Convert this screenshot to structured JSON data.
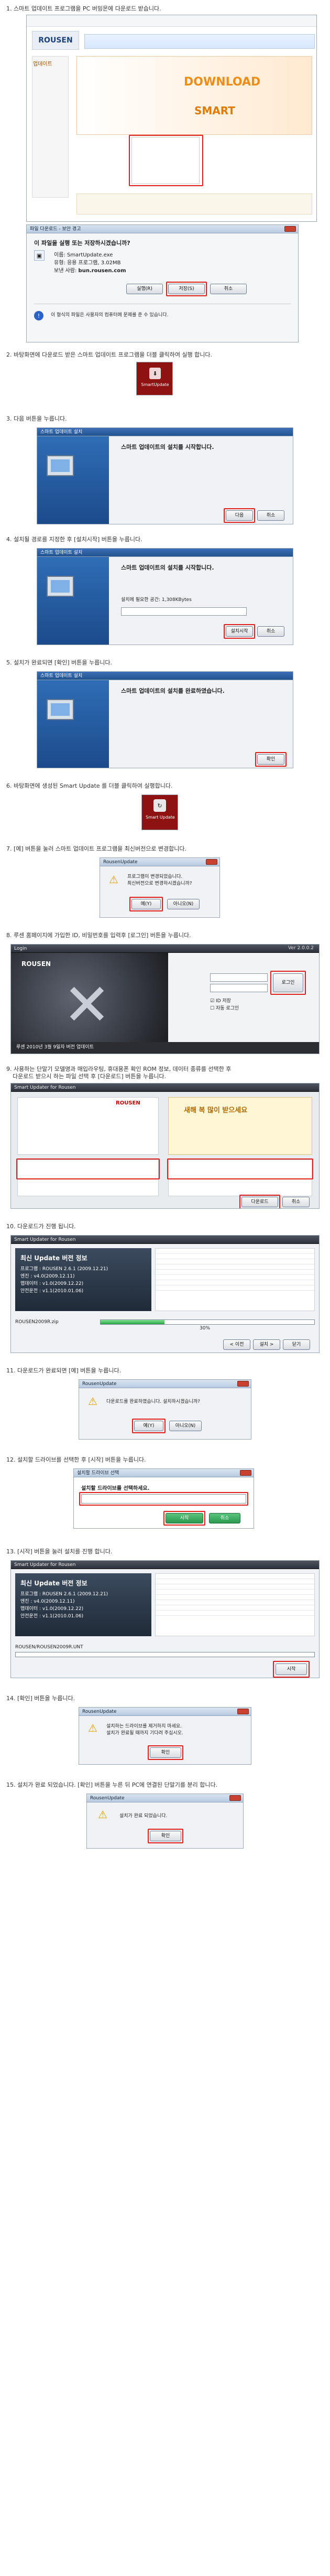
{
  "steps": {
    "s1": "1. 스마트 업데이트 프로그램을 PC 버밍몬에 다운로드 받습니다.",
    "s2": "2. 바탕화면에 다운로드 받은 스마트 업데이트 프로그램을 더블 클릭하여 실행 합니다.",
    "s3": "3. 다음 버튼을 누릅니다.",
    "s4": "4. 설치될 경로를 지정한 후 [설치시작] 버튼을 누릅니다.",
    "s5": "5. 설치가 완료되면 [확인] 버튼을 누릅니다.",
    "s6": "6. 바탕화면에 생성된 Smart Update 를 더블 클릭하여 실행합니다.",
    "s7": "7. [예] 버튼을 눌러 스마트 업데이트 프로그램을 최신버전으로 변경합니다.",
    "s8": "8. 루센 홈페이지에 가입한 ID, 비밀번호를 입력후 [로그인] 버튼을 누릅니다.",
    "s9a": "9. 사용하는 단말기 모델명과 매입라우팅, 휴대용폰 확인 ROM 정보, 데이터 종류를 선택한 후",
    "s9b": "다운로드 받으시 하는 파일 선택 후 [다운로드] 버튼을 누릅니다.",
    "s10": "10. 다운로드가 진행 됩니다.",
    "s11": "11. 다운로드가 완료되면 [예] 버튼을 누릅니다.",
    "s12": "12. 설치할 드라이브를 선택한 후 [시작] 버튼을 누릅니다.",
    "s13": "13. [시작] 버튼을 눌러 설치를 진행 합니다.",
    "s14": "14. [확인] 버튼을 누릅니다.",
    "s15": "15. 설치가 완료 되었습니다. [확인] 버튼을 누른 뒤 PC에 연결된 단말기를 분리 합니다."
  },
  "web": {
    "logo": "ROUSEN",
    "download_banner": "DOWNLOAD",
    "smart_text": "SMART",
    "menu_title": "업데이트"
  },
  "security": {
    "title": "파일 다운로드 - 보안 경고",
    "question": "이 파일을 실행 또는 저장하시겠습니까?",
    "name_label": "이름:",
    "name_value": "SmartUpdate.exe",
    "type_label": "유형:",
    "type_value": "응용 프로그램, 3.02MB",
    "from_label": "보낸 사람:",
    "from_value": "bun.rousen.com",
    "run": "실행(R)",
    "save": "저장(S)",
    "cancel": "취소",
    "warning": "이 형식의 파일은 사용자의 컴퓨터에 문제를 준 수 있습니다."
  },
  "desktop_icon1": "SmartUpdate",
  "setup": {
    "title": "스마트 업데이트 설치",
    "welcome": "스마트 업데이트의 설치를 시작합니다.",
    "next": "다음",
    "cancel": "취소",
    "install": "설치시작",
    "space": "설치에 필요한 공간: 1,308KBytes",
    "done": "스마트 업데이트의 설치를 완료하였습니다.",
    "ok": "확인"
  },
  "desktop_icon2": "Smart Update",
  "upd_dialog": {
    "title": "RousenUpdate",
    "line1": "프로그램이 변경되었습니다.",
    "line2": "최신버전으로 변경하시겠습니까?",
    "yes": "예(Y)",
    "no": "아니오(N)"
  },
  "login": {
    "title": "Login",
    "version": "Ver 2.0.0.2",
    "remember_id": "ID 저장",
    "auto_login": "자동 로그인",
    "button": "로그인",
    "notice": "루센 2010년 3월 9일자 버전 업데이트"
  },
  "smart": {
    "title": "Smart Updater for Rousen",
    "logo": "ROUSEN",
    "banner": "새해 복 많이 받으세요",
    "download": "다운로드",
    "cancel": "취소"
  },
  "progress": {
    "title": "Smart Updater for Rousen",
    "heading": "최신 Update 버전 정보",
    "labels": [
      "프로그램",
      "엔진",
      "맵데이터",
      "안전운전"
    ],
    "values": [
      "ROUSEN 2.6.1 (2009.12.21)",
      "v4.0(2009.12.11)",
      "v1.0(2009.12.22)",
      "v1.1(2010.01.06)"
    ],
    "percent": "30%",
    "file": "ROUSEN2009R.zip",
    "prev": "< 이전",
    "next": "설치 >",
    "close": "닫기"
  },
  "dl_done": {
    "title": "RousenUpdate",
    "text": "다운로드를 완료하였습니다. 설치하시겠습니까?",
    "yes": "예(Y)",
    "no": "아니오(N)"
  },
  "drive": {
    "title": "설치할 드라이브 선택",
    "heading": "설치할 드라이브를 선택하세요.",
    "start": "시작",
    "cancel": "취소"
  },
  "install13": {
    "title": "Smart Updater for Rousen",
    "heading": "최신 Update 버전 정보",
    "path": "ROUSEN/ROUSEN2009R.UNT",
    "start": "시작"
  },
  "finish14": {
    "title": "RousenUpdate",
    "line1": "설치하는 드라이브를 제거하지 마세요.",
    "line2": "설치가 완료될 때까지 기다려 주십시오.",
    "ok": "확인"
  },
  "finish15": {
    "title": "RousenUpdate",
    "text": "설치가 완료 되었습니다.",
    "ok": "확인"
  }
}
